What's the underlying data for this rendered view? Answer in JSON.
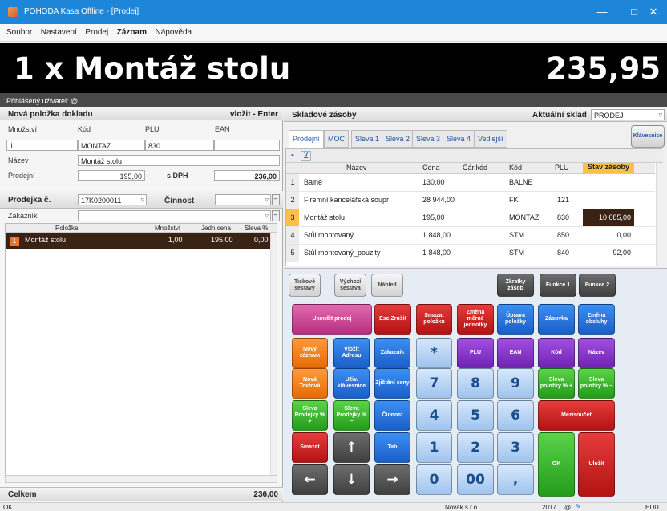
{
  "window": {
    "title": "POHODA Kasa Offline - [Prodej]",
    "min": "—",
    "max": "□",
    "close": "✕"
  },
  "menu": [
    "Soubor",
    "Nastavení",
    "Prodej",
    "Záznam",
    "Nápověda"
  ],
  "banner": {
    "item": "1 x  Montáž stolu",
    "total": "235,95"
  },
  "user": "Přihlášený uživatel: @",
  "new_item": {
    "title": "Nová položka dokladu",
    "hint": "vložit - Enter",
    "qty_label": "Množství",
    "code_label": "Kód",
    "plu_label": "PLU",
    "ean_label": "EAN",
    "qty": "1",
    "code": "MONTAZ",
    "plu": "830",
    "ean": "",
    "name_label": "Název",
    "name": "Montáž stolu",
    "price_label": "Prodejní",
    "price": "195,00",
    "vat_label": "s DPH",
    "price_vat": "236,00"
  },
  "receipt": {
    "label": "Prodejka č.",
    "number": "17K0200011",
    "activity_label": "Činnost",
    "customer_label": "Zákazník",
    "cols": [
      "Položka",
      "Množství",
      "Jedn.cena",
      "Sleva %"
    ],
    "rows": [
      {
        "n": "1",
        "name": "Montáž stolu",
        "qty": "1,00",
        "price": "195,00",
        "disc": "0,00"
      }
    ],
    "total_label": "Celkem",
    "total": "236,00"
  },
  "stock": {
    "title": "Skladové zásoby",
    "warehouse_label": "Aktuální sklad",
    "warehouse": "PRODEJ",
    "tabs": [
      "Prodejní",
      "MOC",
      "Sleva 1",
      "Sleva 2",
      "Sleva 3",
      "Sleva 4",
      "Vedlejší"
    ],
    "keyboard_btn": "Klávesnice",
    "cols": [
      "Název",
      "Cena",
      "Čár.kód",
      "Kód",
      "PLU",
      "Stav zásoby"
    ],
    "rows": [
      {
        "n": "1",
        "name": "Balné",
        "price": "130,00",
        "bar": "",
        "code": "BALNE",
        "plu": "",
        "stock": ""
      },
      {
        "n": "2",
        "name": "Firemní kancelářská soupr",
        "price": "28 944,00",
        "bar": "",
        "code": "FK",
        "plu": "121",
        "stock": ""
      },
      {
        "n": "3",
        "name": "Montáž stolu",
        "price": "195,00",
        "bar": "",
        "code": "MONTAZ",
        "plu": "830",
        "stock": "10 085,00"
      },
      {
        "n": "4",
        "name": "Stůl montovaný",
        "price": "1 848,00",
        "bar": "",
        "code": "STM",
        "plu": "850",
        "stock": "0,00"
      },
      {
        "n": "5",
        "name": "Stůl montovaný_pouzity",
        "price": "1 848,00",
        "bar": "",
        "code": "STM",
        "plu": "840",
        "stock": "92,00"
      }
    ]
  },
  "buttons": {
    "tisk": "Tiskové sestavy",
    "vychozi": "Výchozí sestava",
    "nahled": "Náhled",
    "zkratky": "Zkratky zásob",
    "f1": "Funkce 1",
    "f2": "Funkce 2",
    "ukoncit": "Ukončit prodej",
    "esc": "Esc Zrušit",
    "smazat_pol": "Smazat položku",
    "zmena_mj": "Změna měrné jednotky",
    "uprava": "Úprava položky",
    "zasuvka": "Zásuvka",
    "zmena_obs": "Změna obsluhy",
    "novy_zaznam": "Nový záznam",
    "vlozit_adresu": "Vložit Adresu",
    "zakaznik": "Zákazník",
    "star": "*",
    "plu": "PLU",
    "ean": "EAN",
    "kod": "Kód",
    "nazev": "Název",
    "nova_textova": "Nová Textová",
    "uziv_klav": "Uživ. klávesnice",
    "zjisteni": "Zjištění ceny",
    "sleva_pol_plus": "Sleva položky % +",
    "sleva_pol_minus": "Sleva položky % −",
    "sleva_prod_plus": "Sleva Prodejky % +",
    "sleva_prod_minus": "Sleva Prodejky % −",
    "cinnost": "Činnost",
    "mezisoucet": "Mezisoučet",
    "smazat": "Smazat",
    "tab": "Tab",
    "ok": "OK",
    "ulozit": "Uložit",
    "d7": "7",
    "d8": "8",
    "d9": "9",
    "d4": "4",
    "d5": "5",
    "d6": "6",
    "d1": "1",
    "d2": "2",
    "d3": "3",
    "d0": "0",
    "d00": "00",
    "comma": ",",
    "up": "↑",
    "down": "↓",
    "left": "←",
    "right": "→",
    "back": "⟵",
    "tabarrow": "⟶"
  },
  "status": {
    "left": "OK",
    "company": "Novák s.r.o.",
    "year": "2017",
    "at": "@",
    "mode": "EDIT"
  }
}
